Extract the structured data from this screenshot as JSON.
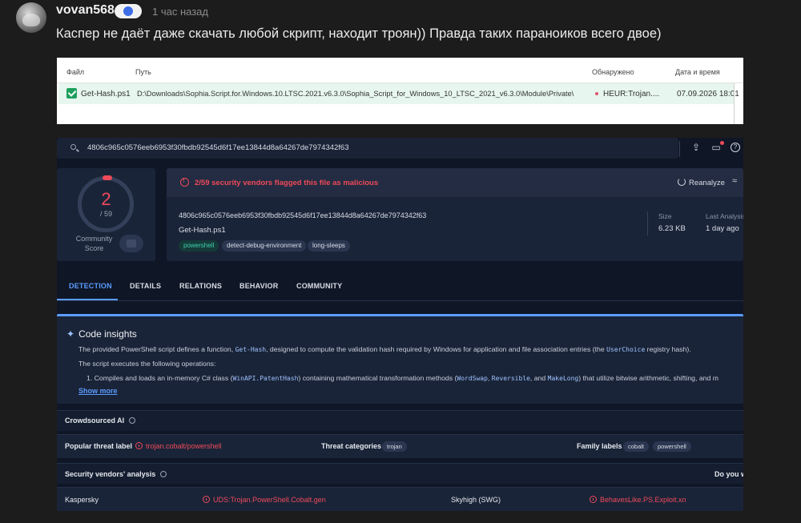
{
  "comment": {
    "username": "vovan568",
    "time": "1 час назад",
    "text": "Каспер не даёт даже скачать любой скрипт, находит троян)) Правда таких параноиков всего двое)"
  },
  "kaspersky": {
    "columns": [
      "Файл",
      "Путь",
      "Обнаружено",
      "Дата и время"
    ],
    "row": {
      "file": "Get-Hash.ps1",
      "path": "D:\\Downloads\\Sophia.Script.for.Windows.10.LTSC.2021.v6.3.0\\Sophia_Script_for_Windows_10_LTSC_2021_v6.3.0\\Module\\Private\\",
      "detected": "HEUR:Trojan....",
      "datetime": "07.09.2026 18:01"
    }
  },
  "virustotal": {
    "search_value": "4806c965c0576eeb6953f30fbdb92545d6f17ee13844d8a64267de7974342f63",
    "icons": [
      "upload-icon",
      "notifications-icon",
      "help-icon"
    ],
    "score": {
      "detections": "2",
      "total": "/ 59",
      "community_label_1": "Community",
      "community_label_2": "Score"
    },
    "flag_text": "2/59 security vendors flagged this file as malicious",
    "reanalyze": "Reanalyze",
    "hash": "4806c965c0576eeb6953f30fbdb92545d6f17ee13844d8a64267de7974342f63",
    "filename": "Get-Hash.ps1",
    "tags": [
      "powershell",
      "detect-debug-environment",
      "long-sleeps"
    ],
    "size_label": "Size",
    "size_value": "6.23 KB",
    "last_analysis_label": "Last Analysis",
    "last_analysis_value": "1 day ago",
    "tabs": [
      "DETECTION",
      "DETAILS",
      "RELATIONS",
      "BEHAVIOR",
      "COMMUNITY"
    ],
    "insights": {
      "title": "Code insights",
      "p1_a": "The provided PowerShell script defines a function, ",
      "p1_code": "Get-Hash",
      "p1_b": ", designed to compute the validation hash required by Windows for application and file association entries (the ",
      "p1_code2": "UserChoice",
      "p1_c": " registry hash).",
      "p2": "The script executes the following operations:",
      "p3_a": "1. Compiles and loads an in-memory C# class (",
      "p3_code": "WinAPI.PatentHash",
      "p3_b": ") containing mathematical transformation methods (",
      "p3_code2": "WordSwap",
      "p3_c": ", ",
      "p3_code3": "Reversible",
      "p3_d": ", and ",
      "p3_code4": "MakeLong",
      "p3_e": ") that utilize bitwise arithmetic, shifting, and m",
      "show_more": "Show more"
    },
    "crowdsourced_title": "Crowdsourced AI",
    "popular_label": "Popular threat label",
    "popular_value": "trojan.cobalt/powershell",
    "categories_label": "Threat categories",
    "categories": [
      "trojan"
    ],
    "family_label": "Family labels",
    "families": [
      "cobalt",
      "powershell"
    ],
    "vendors_title": "Security vendors' analysis",
    "vendors_right": "Do you w",
    "vendors": [
      {
        "name": "Kaspersky",
        "result": "UDS:Trojan.PowerShell.Cobalt.gen"
      },
      {
        "name": "Skyhigh (SWG)",
        "result": "BehavesLike.PS.Exploit.xn"
      }
    ]
  }
}
